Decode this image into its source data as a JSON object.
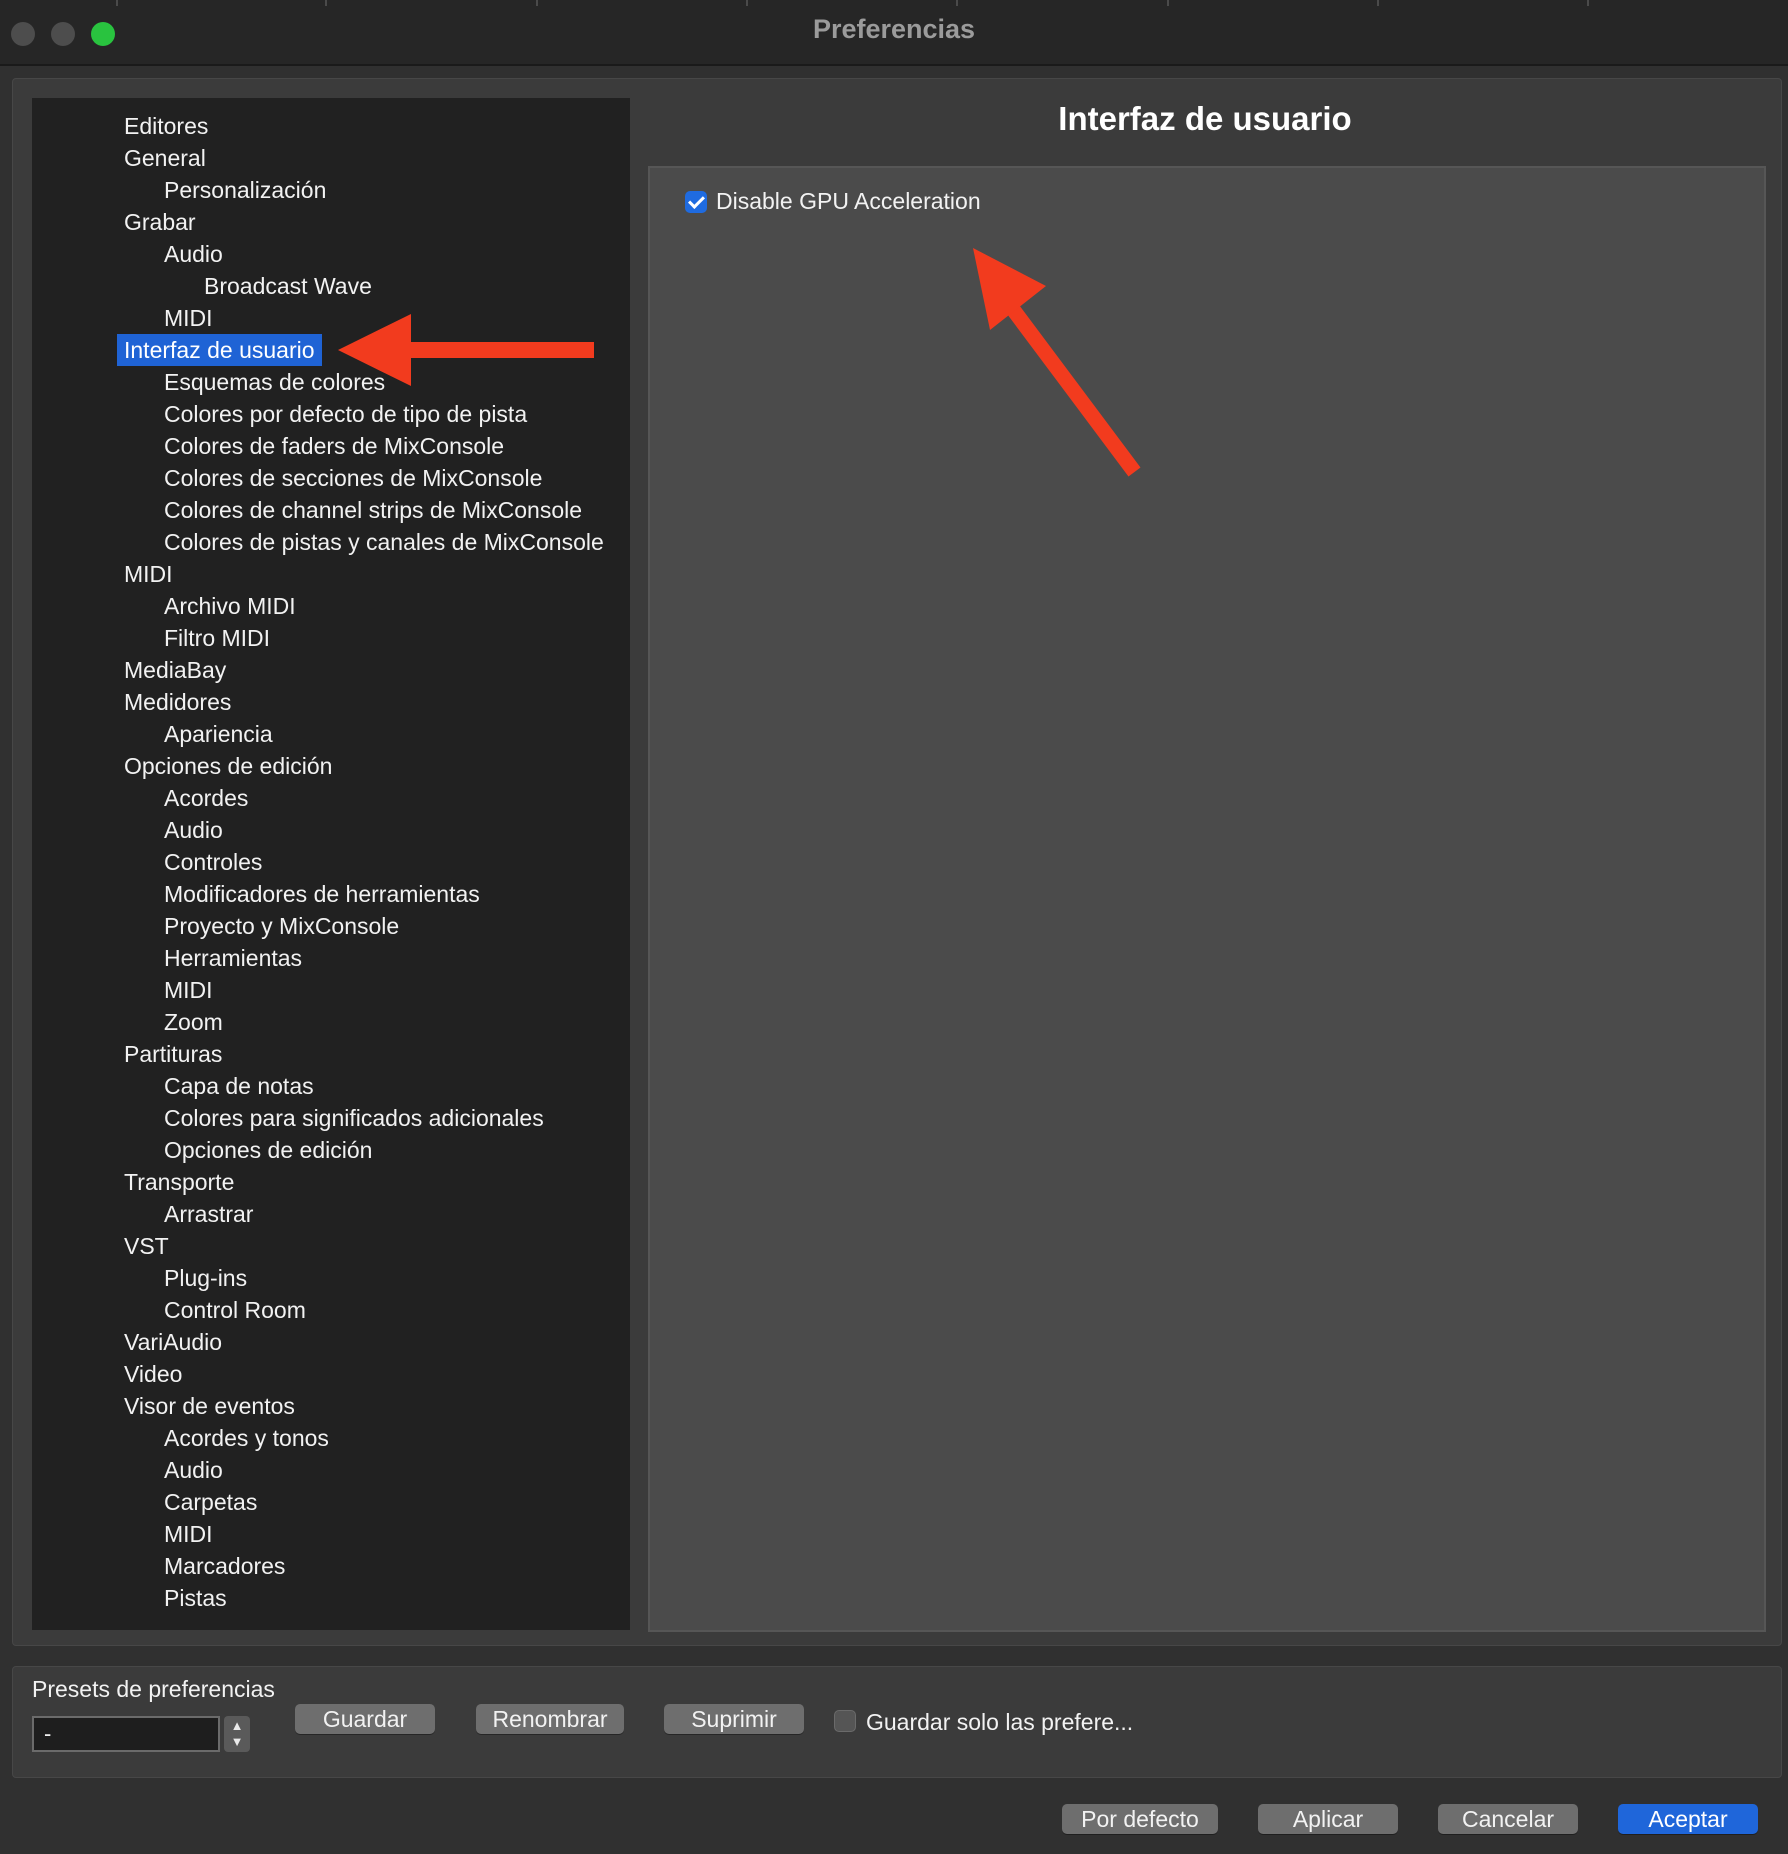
{
  "window": {
    "title": "Preferencias",
    "controls": [
      "close",
      "minimize",
      "zoom"
    ]
  },
  "tree": {
    "selected": "Interfaz de usuario",
    "items": [
      {
        "label": "Editores",
        "level": 0
      },
      {
        "label": "General",
        "level": 0
      },
      {
        "label": "Personalización",
        "level": 1
      },
      {
        "label": "Grabar",
        "level": 0
      },
      {
        "label": "Audio",
        "level": 1
      },
      {
        "label": "Broadcast Wave",
        "level": 2
      },
      {
        "label": "MIDI",
        "level": 1
      },
      {
        "label": "Interfaz de usuario",
        "level": 0
      },
      {
        "label": "Esquemas de colores",
        "level": 1
      },
      {
        "label": "Colores por defecto de tipo de pista",
        "level": 1
      },
      {
        "label": "Colores de faders de MixConsole",
        "level": 1
      },
      {
        "label": "Colores de secciones de MixConsole",
        "level": 1
      },
      {
        "label": "Colores de channel strips de MixConsole",
        "level": 1
      },
      {
        "label": "Colores de pistas y canales de MixConsole",
        "level": 1
      },
      {
        "label": "MIDI",
        "level": 0
      },
      {
        "label": "Archivo MIDI",
        "level": 1
      },
      {
        "label": "Filtro MIDI",
        "level": 1
      },
      {
        "label": "MediaBay",
        "level": 0
      },
      {
        "label": "Medidores",
        "level": 0
      },
      {
        "label": "Apariencia",
        "level": 1
      },
      {
        "label": "Opciones de edición",
        "level": 0
      },
      {
        "label": "Acordes",
        "level": 1
      },
      {
        "label": "Audio",
        "level": 1
      },
      {
        "label": "Controles",
        "level": 1
      },
      {
        "label": "Modificadores de herramientas",
        "level": 1
      },
      {
        "label": "Proyecto y MixConsole",
        "level": 1
      },
      {
        "label": "Herramientas",
        "level": 1
      },
      {
        "label": "MIDI",
        "level": 1
      },
      {
        "label": "Zoom",
        "level": 1
      },
      {
        "label": "Partituras",
        "level": 0
      },
      {
        "label": "Capa de notas",
        "level": 1
      },
      {
        "label": "Colores para significados adicionales",
        "level": 1
      },
      {
        "label": "Opciones de edición",
        "level": 1
      },
      {
        "label": "Transporte",
        "level": 0
      },
      {
        "label": "Arrastrar",
        "level": 1
      },
      {
        "label": "VST",
        "level": 0
      },
      {
        "label": "Plug-ins",
        "level": 1
      },
      {
        "label": "Control Room",
        "level": 1
      },
      {
        "label": "VariAudio",
        "level": 0
      },
      {
        "label": "Video",
        "level": 0
      },
      {
        "label": "Visor de eventos",
        "level": 0
      },
      {
        "label": "Acordes y tonos",
        "level": 1
      },
      {
        "label": "Audio",
        "level": 1
      },
      {
        "label": "Carpetas",
        "level": 1
      },
      {
        "label": "MIDI",
        "level": 1
      },
      {
        "label": "Marcadores",
        "level": 1
      },
      {
        "label": "Pistas",
        "level": 1
      }
    ]
  },
  "content": {
    "title": "Interfaz de usuario",
    "gpu_option": {
      "label": "Disable GPU Acceleration",
      "checked": true
    }
  },
  "presets": {
    "label": "Presets de preferencias",
    "value": "-",
    "save_label": "Guardar",
    "rename_label": "Renombrar",
    "delete_label": "Suprimir",
    "save_only": {
      "label": "Guardar solo las prefere...",
      "checked": false
    }
  },
  "footer": {
    "defaults_label": "Por defecto",
    "apply_label": "Aplicar",
    "cancel_label": "Cancelar",
    "ok_label": "Aceptar"
  },
  "annotations": [
    {
      "type": "arrow",
      "color": "#f23b1e",
      "points_to": "Interfaz de usuario"
    },
    {
      "type": "arrow",
      "color": "#f23b1e",
      "points_to": "Disable GPU Acceleration"
    }
  ],
  "colors": {
    "selection": "#1f63d5",
    "primary_button": "#1f66da",
    "annotation_arrow": "#f23b1e",
    "zoom_button": "#29c33f"
  }
}
